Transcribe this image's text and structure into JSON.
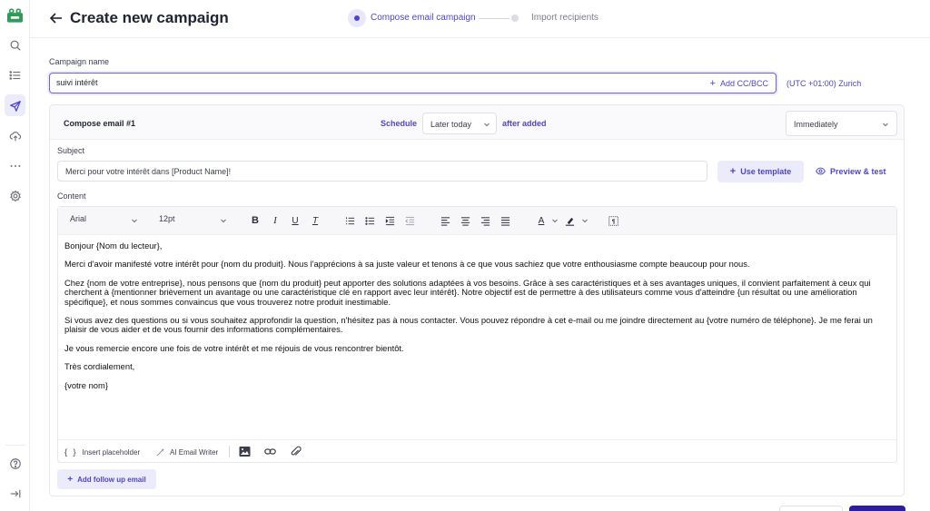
{
  "header": {
    "title": "Create new campaign",
    "steps": [
      {
        "label": "Compose email campaign",
        "active": true
      },
      {
        "label": "Import recipients",
        "active": false
      }
    ]
  },
  "sidebar": {
    "items": [
      {
        "icon": "search-icon"
      },
      {
        "icon": "list-icon"
      },
      {
        "icon": "send-icon",
        "active": true
      },
      {
        "icon": "upload-cloud-icon"
      },
      {
        "icon": "more-dots-icon"
      },
      {
        "icon": "settings-icon"
      },
      {
        "icon": "help-icon"
      },
      {
        "icon": "collapse-icon"
      }
    ]
  },
  "campaign": {
    "name_label": "Campaign name",
    "name_value": "suivi intérêt",
    "cc_bcc_label": "Add CC/BCC",
    "timezone": "(UTC +01:00) Zurich"
  },
  "compose": {
    "title": "Compose email #1",
    "schedule_label": "Schedule",
    "schedule_value": "Later today",
    "after_added": "after added",
    "timing_value": "Immediately",
    "subject_label": "Subject",
    "subject_value": "Merci pour votre intérêt dans [Product Name]!",
    "use_template": "Use template",
    "preview_test": "Preview & test",
    "content_label": "Content",
    "toolbar": {
      "font": "Arial",
      "size": "12pt"
    },
    "body": [
      "Bonjour {Nom du lecteur},",
      "Merci d'avoir manifesté votre intérêt pour {nom du produit}. Nous l'apprécions à sa juste valeur et tenons à ce que vous sachiez que votre enthousiasme compte beaucoup pour nous.",
      "Chez {nom de votre entreprise}, nous pensons que {nom du produit} peut apporter des solutions adaptées à vos besoins. Grâce à ses caractéristiques et à ses avantages uniques, il convient parfaitement à ceux qui cherchent à {mentionner brièvement un avantage ou une caractéristique clé en rapport avec leur intérêt}. Notre objectif est de permettre à des utilisateurs comme vous d'atteindre {un résultat ou une amélioration spécifique}, et nous sommes convaincus que vous trouverez notre produit inestimable.",
      "Si vous avez des questions ou si vous souhaitez approfondir la question, n'hésitez pas à nous contacter. Vous pouvez répondre à cet e-mail ou me joindre directement au {votre numéro de téléphone}. Je me ferai un plaisir de vous aider et de vous fournir des informations complémentaires.",
      "Je vous remercie encore une fois de votre intérêt et me réjouis de vous rencontrer bientôt.",
      "Très cordialement,",
      "{votre nom}"
    ],
    "insert_placeholder": "Insert placeholder",
    "ai_writer": "AI Email Writer",
    "follow_up": "Add follow up email"
  },
  "colors": {
    "accent": "#4f46c8",
    "accent_light": "#ecebfb",
    "primary_dark": "#2d1e9e"
  }
}
